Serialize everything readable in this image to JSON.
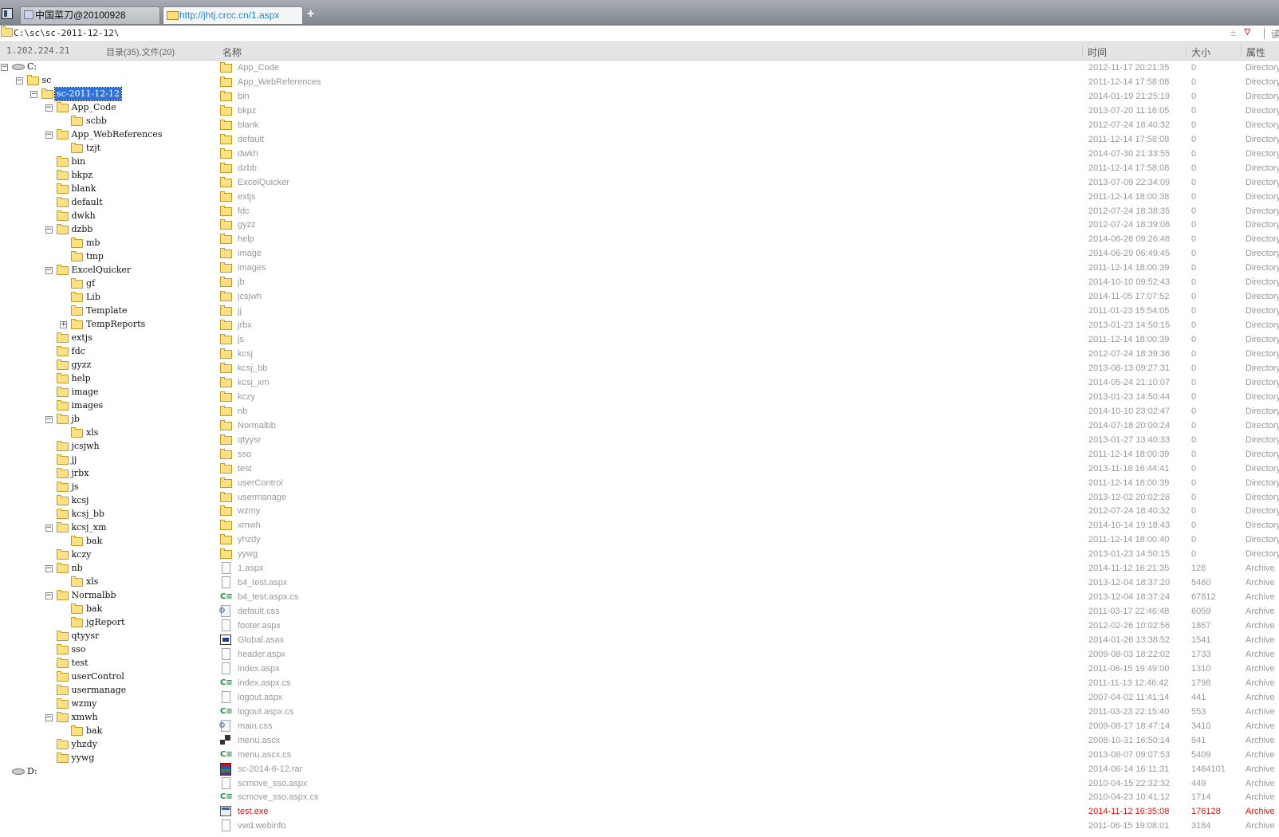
{
  "tabs": [
    {
      "label": "中国菜刀@20100928",
      "active": false
    },
    {
      "label": "http://jhtj.crcc.cn/1.aspx",
      "active": true
    }
  ],
  "address": {
    "path": "C:\\sc\\sc-2011-12-12\\",
    "plus": "±",
    "chevron": "▽",
    "go_label": "读"
  },
  "info": {
    "ip": "1.202.224.21",
    "counts": "目录(35),文件(20)"
  },
  "columns": {
    "name": "名称",
    "time": "时间",
    "size": "大小",
    "attr": "属性"
  },
  "tree": [
    {
      "label": "C:",
      "depth": 0,
      "type": "drive",
      "toggle": "minus"
    },
    {
      "label": "sc",
      "depth": 1,
      "type": "folder",
      "toggle": "minus"
    },
    {
      "label": "sc-2011-12-12",
      "depth": 2,
      "type": "folder",
      "toggle": "minus",
      "selected": true
    },
    {
      "label": "App_Code",
      "depth": 3,
      "type": "folder",
      "toggle": "minus"
    },
    {
      "label": "scbb",
      "depth": 4,
      "type": "folder",
      "toggle": ""
    },
    {
      "label": "App_WebReferences",
      "depth": 3,
      "type": "folder",
      "toggle": "minus"
    },
    {
      "label": "tzjt",
      "depth": 4,
      "type": "folder",
      "toggle": ""
    },
    {
      "label": "bin",
      "depth": 3,
      "type": "folder",
      "toggle": ""
    },
    {
      "label": "bkpz",
      "depth": 3,
      "type": "folder",
      "toggle": ""
    },
    {
      "label": "blank",
      "depth": 3,
      "type": "folder",
      "toggle": ""
    },
    {
      "label": "default",
      "depth": 3,
      "type": "folder",
      "toggle": ""
    },
    {
      "label": "dwkh",
      "depth": 3,
      "type": "folder",
      "toggle": ""
    },
    {
      "label": "dzbb",
      "depth": 3,
      "type": "folder",
      "toggle": "minus"
    },
    {
      "label": "mb",
      "depth": 4,
      "type": "folder",
      "toggle": ""
    },
    {
      "label": "tmp",
      "depth": 4,
      "type": "folder",
      "toggle": ""
    },
    {
      "label": "ExcelQuicker",
      "depth": 3,
      "type": "folder",
      "toggle": "minus"
    },
    {
      "label": "gf",
      "depth": 4,
      "type": "folder",
      "toggle": ""
    },
    {
      "label": "Lib",
      "depth": 4,
      "type": "folder",
      "toggle": ""
    },
    {
      "label": "Template",
      "depth": 4,
      "type": "folder",
      "toggle": ""
    },
    {
      "label": "TempReports",
      "depth": 4,
      "type": "folder",
      "toggle": "plus"
    },
    {
      "label": "extjs",
      "depth": 3,
      "type": "folder",
      "toggle": ""
    },
    {
      "label": "fdc",
      "depth": 3,
      "type": "folder",
      "toggle": ""
    },
    {
      "label": "gyzz",
      "depth": 3,
      "type": "folder",
      "toggle": ""
    },
    {
      "label": "help",
      "depth": 3,
      "type": "folder",
      "toggle": ""
    },
    {
      "label": "image",
      "depth": 3,
      "type": "folder",
      "toggle": ""
    },
    {
      "label": "images",
      "depth": 3,
      "type": "folder",
      "toggle": ""
    },
    {
      "label": "jb",
      "depth": 3,
      "type": "folder",
      "toggle": "minus"
    },
    {
      "label": "xls",
      "depth": 4,
      "type": "folder",
      "toggle": ""
    },
    {
      "label": "jcsjwh",
      "depth": 3,
      "type": "folder",
      "toggle": ""
    },
    {
      "label": "jj",
      "depth": 3,
      "type": "folder",
      "toggle": ""
    },
    {
      "label": "jrbx",
      "depth": 3,
      "type": "folder",
      "toggle": ""
    },
    {
      "label": "js",
      "depth": 3,
      "type": "folder",
      "toggle": ""
    },
    {
      "label": "kcsj",
      "depth": 3,
      "type": "folder",
      "toggle": ""
    },
    {
      "label": "kcsj_bb",
      "depth": 3,
      "type": "folder",
      "toggle": ""
    },
    {
      "label": "kcsj_xm",
      "depth": 3,
      "type": "folder",
      "toggle": "minus"
    },
    {
      "label": "bak",
      "depth": 4,
      "type": "folder",
      "toggle": ""
    },
    {
      "label": "kczy",
      "depth": 3,
      "type": "folder",
      "toggle": ""
    },
    {
      "label": "nb",
      "depth": 3,
      "type": "folder",
      "toggle": "minus"
    },
    {
      "label": "xls",
      "depth": 4,
      "type": "folder",
      "toggle": ""
    },
    {
      "label": "Normalbb",
      "depth": 3,
      "type": "folder",
      "toggle": "minus"
    },
    {
      "label": "bak",
      "depth": 4,
      "type": "folder",
      "toggle": ""
    },
    {
      "label": "jgReport",
      "depth": 4,
      "type": "folder",
      "toggle": ""
    },
    {
      "label": "qtyysr",
      "depth": 3,
      "type": "folder",
      "toggle": ""
    },
    {
      "label": "sso",
      "depth": 3,
      "type": "folder",
      "toggle": ""
    },
    {
      "label": "test",
      "depth": 3,
      "type": "folder",
      "toggle": ""
    },
    {
      "label": "userControl",
      "depth": 3,
      "type": "folder",
      "toggle": ""
    },
    {
      "label": "usermanage",
      "depth": 3,
      "type": "folder",
      "toggle": ""
    },
    {
      "label": "wzmy",
      "depth": 3,
      "type": "folder",
      "toggle": ""
    },
    {
      "label": "xmwh",
      "depth": 3,
      "type": "folder",
      "toggle": "minus"
    },
    {
      "label": "bak",
      "depth": 4,
      "type": "folder",
      "toggle": ""
    },
    {
      "label": "yhzdy",
      "depth": 3,
      "type": "folder",
      "toggle": ""
    },
    {
      "label": "yywg",
      "depth": 3,
      "type": "folder",
      "toggle": ""
    },
    {
      "label": "D:",
      "depth": 0,
      "type": "drive",
      "toggle": ""
    }
  ],
  "files": [
    {
      "name": "App_Code",
      "time": "2012-11-17 20:21:35",
      "size": "0",
      "attr": "Directory",
      "icon": "folder"
    },
    {
      "name": "App_WebReferences",
      "time": "2011-12-14 17:58:08",
      "size": "0",
      "attr": "Directory",
      "icon": "folder"
    },
    {
      "name": "bin",
      "time": "2014-01-19 21:25:19",
      "size": "0",
      "attr": "Directory",
      "icon": "folder"
    },
    {
      "name": "bkpz",
      "time": "2013-07-20 11:16:05",
      "size": "0",
      "attr": "Directory",
      "icon": "folder"
    },
    {
      "name": "blank",
      "time": "2012-07-24 18:40:32",
      "size": "0",
      "attr": "Directory",
      "icon": "folder"
    },
    {
      "name": "default",
      "time": "2011-12-14 17:58:08",
      "size": "0",
      "attr": "Directory",
      "icon": "folder"
    },
    {
      "name": "dwkh",
      "time": "2014-07-30 21:33:55",
      "size": "0",
      "attr": "Directory",
      "icon": "folder"
    },
    {
      "name": "dzbb",
      "time": "2011-12-14 17:58:08",
      "size": "0",
      "attr": "Directory",
      "icon": "folder"
    },
    {
      "name": "ExcelQuicker",
      "time": "2013-07-09 22:34:09",
      "size": "0",
      "attr": "Directory",
      "icon": "folder"
    },
    {
      "name": "extjs",
      "time": "2011-12-14 18:00:38",
      "size": "0",
      "attr": "Directory",
      "icon": "folder"
    },
    {
      "name": "fdc",
      "time": "2012-07-24 18:38:35",
      "size": "0",
      "attr": "Directory",
      "icon": "folder"
    },
    {
      "name": "gyzz",
      "time": "2012-07-24 18:39:08",
      "size": "0",
      "attr": "Directory",
      "icon": "folder"
    },
    {
      "name": "help",
      "time": "2014-06-26 09:26:48",
      "size": "0",
      "attr": "Directory",
      "icon": "folder"
    },
    {
      "name": "image",
      "time": "2014-06-29 06:49:45",
      "size": "0",
      "attr": "Directory",
      "icon": "folder"
    },
    {
      "name": "images",
      "time": "2011-12-14 18:00:39",
      "size": "0",
      "attr": "Directory",
      "icon": "folder"
    },
    {
      "name": "jb",
      "time": "2014-10-10 09:52:43",
      "size": "0",
      "attr": "Directory",
      "icon": "folder"
    },
    {
      "name": "jcsjwh",
      "time": "2014-11-05 17:07:52",
      "size": "0",
      "attr": "Directory",
      "icon": "folder"
    },
    {
      "name": "jj",
      "time": "2011-01-23 15:54:05",
      "size": "0",
      "attr": "Directory",
      "icon": "folder"
    },
    {
      "name": "jrbx",
      "time": "2013-01-23 14:50:15",
      "size": "0",
      "attr": "Directory",
      "icon": "folder"
    },
    {
      "name": "js",
      "time": "2011-12-14 18:00:39",
      "size": "0",
      "attr": "Directory",
      "icon": "folder"
    },
    {
      "name": "kcsj",
      "time": "2012-07-24 18:39:36",
      "size": "0",
      "attr": "Directory",
      "icon": "folder"
    },
    {
      "name": "kcsj_bb",
      "time": "2013-08-13 09:27:31",
      "size": "0",
      "attr": "Directory",
      "icon": "folder"
    },
    {
      "name": "kcsj_xm",
      "time": "2014-05-24 21:10:07",
      "size": "0",
      "attr": "Directory",
      "icon": "folder"
    },
    {
      "name": "kczy",
      "time": "2013-01-23 14:50:44",
      "size": "0",
      "attr": "Directory",
      "icon": "folder"
    },
    {
      "name": "nb",
      "time": "2014-10-10 23:02:47",
      "size": "0",
      "attr": "Directory",
      "icon": "folder"
    },
    {
      "name": "Normalbb",
      "time": "2014-07-18 20:00:24",
      "size": "0",
      "attr": "Directory",
      "icon": "folder"
    },
    {
      "name": "qtyysr",
      "time": "2013-01-27 13:40:33",
      "size": "0",
      "attr": "Directory",
      "icon": "folder"
    },
    {
      "name": "sso",
      "time": "2011-12-14 18:00:39",
      "size": "0",
      "attr": "Directory",
      "icon": "folder"
    },
    {
      "name": "test",
      "time": "2013-11-18 16:44:41",
      "size": "0",
      "attr": "Directory",
      "icon": "folder"
    },
    {
      "name": "userControl",
      "time": "2011-12-14 18:00:39",
      "size": "0",
      "attr": "Directory",
      "icon": "folder"
    },
    {
      "name": "usermanage",
      "time": "2013-12-02 20:02:26",
      "size": "0",
      "attr": "Directory",
      "icon": "folder"
    },
    {
      "name": "wzmy",
      "time": "2012-07-24 18:40:32",
      "size": "0",
      "attr": "Directory",
      "icon": "folder"
    },
    {
      "name": "xmwh",
      "time": "2014-10-14 19:18:43",
      "size": "0",
      "attr": "Directory",
      "icon": "folder"
    },
    {
      "name": "yhzdy",
      "time": "2011-12-14 18:00:40",
      "size": "0",
      "attr": "Directory",
      "icon": "folder"
    },
    {
      "name": "yywg",
      "time": "2013-01-23 14:50:15",
      "size": "0",
      "attr": "Directory",
      "icon": "folder"
    },
    {
      "name": "1.aspx",
      "time": "2014-11-12 16:21:35",
      "size": "128",
      "attr": "Archive",
      "icon": "doc"
    },
    {
      "name": "b4_test.aspx",
      "time": "2013-12-04 18:37:20",
      "size": "5460",
      "attr": "Archive",
      "icon": "doc"
    },
    {
      "name": "b4_test.aspx.cs",
      "time": "2013-12-04 18:37:24",
      "size": "67812",
      "attr": "Archive",
      "icon": "cs"
    },
    {
      "name": "default.css",
      "time": "2011-03-17 22:46:48",
      "size": "6059",
      "attr": "Archive",
      "icon": "css"
    },
    {
      "name": "footer.aspx",
      "time": "2012-02-26 10:02:56",
      "size": "1867",
      "attr": "Archive",
      "icon": "doc"
    },
    {
      "name": "Global.asax",
      "time": "2014-01-26 13:38:52",
      "size": "1541",
      "attr": "Archive",
      "icon": "asax"
    },
    {
      "name": "header.aspx",
      "time": "2009-08-03 18:22:02",
      "size": "1733",
      "attr": "Archive",
      "icon": "doc"
    },
    {
      "name": "index.aspx",
      "time": "2011-06-15 19:49:00",
      "size": "1310",
      "attr": "Archive",
      "icon": "doc"
    },
    {
      "name": "index.aspx.cs",
      "time": "2011-11-13 12:46:42",
      "size": "1798",
      "attr": "Archive",
      "icon": "cs"
    },
    {
      "name": "logout.aspx",
      "time": "2007-04-02 11:41:14",
      "size": "441",
      "attr": "Archive",
      "icon": "doc"
    },
    {
      "name": "logout.aspx.cs",
      "time": "2011-03-23 22:15:40",
      "size": "553",
      "attr": "Archive",
      "icon": "cs"
    },
    {
      "name": "main.css",
      "time": "2009-08-17 18:47:14",
      "size": "3410",
      "attr": "Archive",
      "icon": "css"
    },
    {
      "name": "menu.ascx",
      "time": "2008-10-31 16:50:14",
      "size": "941",
      "attr": "Archive",
      "icon": "ascx"
    },
    {
      "name": "menu.ascx.cs",
      "time": "2013-08-07 09:07:53",
      "size": "5409",
      "attr": "Archive",
      "icon": "cs"
    },
    {
      "name": "sc-2014-6-12.rar",
      "time": "2014-06-14 16:11:31",
      "size": "1464101",
      "attr": "Archive",
      "icon": "rar"
    },
    {
      "name": "scmove_sso.aspx",
      "time": "2010-04-15 22:32:32",
      "size": "449",
      "attr": "Archive",
      "icon": "doc"
    },
    {
      "name": "scmove_sso.aspx.cs",
      "time": "2010-04-23 10:41:12",
      "size": "1714",
      "attr": "Archive",
      "icon": "cs"
    },
    {
      "name": "test.exe",
      "time": "2014-11-12 16:35:08",
      "size": "176128",
      "attr": "Archive",
      "icon": "exe",
      "highlight": true
    },
    {
      "name": "vwd.webinfo",
      "time": "2011-06-15 19:08:01",
      "size": "3184",
      "attr": "Archive",
      "icon": "doc"
    }
  ]
}
